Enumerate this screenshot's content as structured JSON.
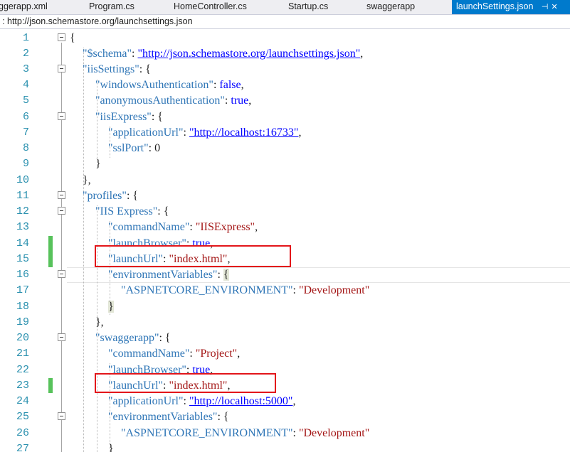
{
  "tabs": [
    {
      "label": "ggerapp.xml"
    },
    {
      "label": "Program.cs"
    },
    {
      "label": "HomeController.cs"
    },
    {
      "label": "Startup.cs"
    },
    {
      "label": "swaggerapp"
    },
    {
      "label": "launchSettings.json"
    }
  ],
  "active_tab_icons": [
    "pin-icon",
    "close-icon"
  ],
  "schema_bar": {
    "prefix": ":",
    "url": "http://json.schemastore.org/launchsettings.json"
  },
  "editor": {
    "line_numbers": [
      "1",
      "2",
      "3",
      "4",
      "5",
      "6",
      "7",
      "8",
      "9",
      "10",
      "11",
      "12",
      "13",
      "14",
      "15",
      "16",
      "17",
      "18",
      "19",
      "20",
      "21",
      "22",
      "23",
      "24",
      "25",
      "26",
      "27"
    ],
    "changed_lines": [
      14,
      15,
      23
    ],
    "highlighted_lines": [
      15,
      23
    ],
    "code": {
      "l2_key": "\"$schema\"",
      "l2_val": "\"http://json.schemastore.org/launchsettings.json\"",
      "l3_key": "\"iisSettings\"",
      "l4_key": "\"windowsAuthentication\"",
      "l4_val": "false",
      "l5_key": "\"anonymousAuthentication\"",
      "l5_val": "true",
      "l6_key": "\"iisExpress\"",
      "l7_key": "\"applicationUrl\"",
      "l7_val": "\"http://localhost:16733\"",
      "l8_key": "\"sslPort\"",
      "l8_val": "0",
      "l11_key": "\"profiles\"",
      "l12_key": "\"IIS Express\"",
      "l13_key": "\"commandName\"",
      "l13_val": "\"IISExpress\"",
      "l14_key": "\"launchBrowser\"",
      "l14_val": "true",
      "l15_key": "\"launchUrl\"",
      "l15_val": "\"index.html\"",
      "l16_key": "\"environmentVariables\"",
      "l17_key": "\"ASPNETCORE_ENVIRONMENT\"",
      "l17_val": "\"Development\"",
      "l20_key": "\"swaggerapp\"",
      "l21_key": "\"commandName\"",
      "l21_val": "\"Project\"",
      "l22_key": "\"launchBrowser\"",
      "l22_val": "true",
      "l23_key": "\"launchUrl\"",
      "l23_val": "\"index.html\"",
      "l24_key": "\"applicationUrl\"",
      "l24_val": "\"http://localhost:5000\"",
      "l25_key": "\"environmentVariables\"",
      "l26_key": "\"ASPNETCORE_ENVIRONMENT\"",
      "l26_val": "\"Development\""
    }
  },
  "colors": {
    "active_tab": "#007acc",
    "highlight_box": "#e3151a",
    "change_marker": "#57c25b",
    "json_key": "#2e75b6",
    "json_string": "#a31515",
    "json_literal": "#0000ff"
  }
}
